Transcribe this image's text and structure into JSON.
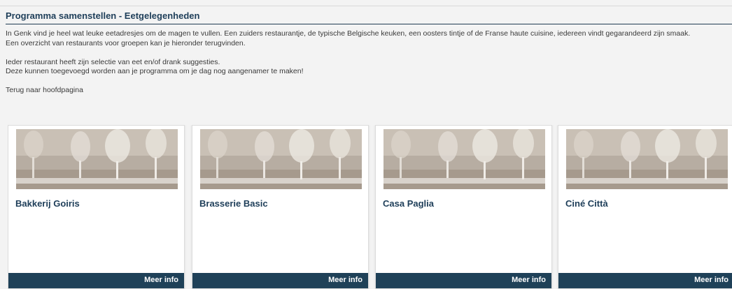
{
  "header": {
    "title": "Programma samenstellen - Eetgelegenheden"
  },
  "intro": {
    "line1": "In Genk vind je heel wat leuke eetadresjes om de magen te vullen.  Een zuiders restaurantje, de typische Belgische keuken, een oosters tintje of de Franse haute cuisine, iedereen vindt gegarandeerd zijn smaak.",
    "line2": "Een overzicht van restaurants voor groepen kan je hieronder terugvinden.",
    "line3": "Ieder restaurant heeft zijn selectie van eet en/of drank suggesties.",
    "line4": "Deze kunnen toegevoegd worden aan je programma om je dag nog aangenamer te maken!",
    "back_link": "Terug naar hoofdpagina"
  },
  "cards": [
    {
      "title": "Bakkerij Goiris",
      "more": "Meer info"
    },
    {
      "title": "Brasserie Basic",
      "more": "Meer info"
    },
    {
      "title": "Casa Paglia",
      "more": "Meer info"
    },
    {
      "title": "Ciné Città",
      "more": "Meer info"
    }
  ],
  "colors": {
    "accent": "#1e3e59",
    "footer": "#1f4158",
    "background": "#f3f3f3"
  },
  "icons": {
    "card_image": "wine-glasses-photo"
  }
}
